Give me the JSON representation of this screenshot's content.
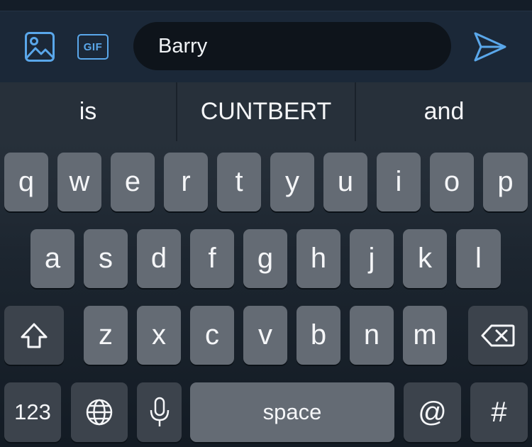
{
  "composer": {
    "image_icon": "image-icon",
    "gif_label": "GIF",
    "message_value": "Barry",
    "send_icon": "send-icon",
    "accent_color": "#5aa7ea"
  },
  "suggestions": [
    "is",
    "CUNTBERT",
    "and"
  ],
  "keyboard": {
    "row1": [
      "q",
      "w",
      "e",
      "r",
      "t",
      "y",
      "u",
      "i",
      "o",
      "p"
    ],
    "row2": [
      "a",
      "s",
      "d",
      "f",
      "g",
      "h",
      "j",
      "k",
      "l"
    ],
    "row3": [
      "z",
      "x",
      "c",
      "v",
      "b",
      "n",
      "m"
    ],
    "shift_icon": "shift-icon",
    "delete_icon": "delete-icon",
    "numbers_label": "123",
    "globe_icon": "globe-icon",
    "mic_icon": "microphone-icon",
    "space_label": "space",
    "at_label": "@",
    "hash_label": "#"
  }
}
